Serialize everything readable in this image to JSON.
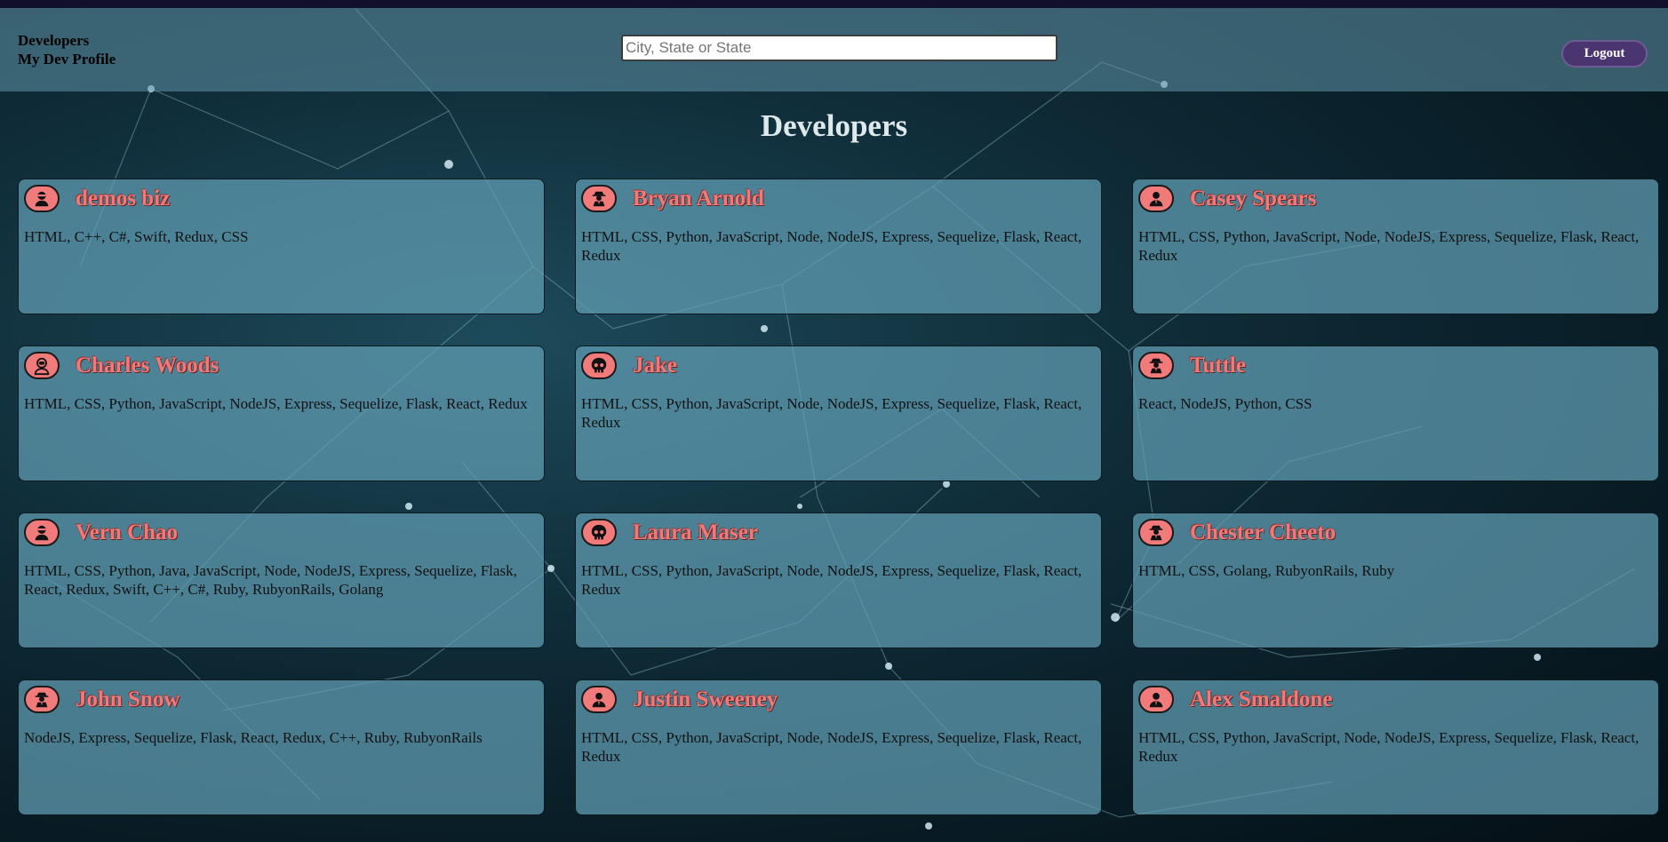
{
  "nav": {
    "links": [
      "Developers",
      "My Dev Profile"
    ]
  },
  "search": {
    "placeholder": "City, State or State",
    "value": ""
  },
  "logout_label": "Logout",
  "page_title": "Developers",
  "developers": [
    {
      "name": "demos biz",
      "icon": "user-ninja-icon",
      "skills": "HTML, C++, C#, Swift, Redux, CSS"
    },
    {
      "name": "Bryan Arnold",
      "icon": "user-secret-icon",
      "skills": "HTML, CSS, Python, JavaScript, Node, NodeJS, Express, Sequelize, Flask, React, Redux"
    },
    {
      "name": "Casey Spears",
      "icon": "user-tie-icon",
      "skills": "HTML, CSS, Python, JavaScript, Node, NodeJS, Express, Sequelize, Flask, React, Redux"
    },
    {
      "name": "Charles Woods",
      "icon": "user-astronaut-icon",
      "skills": "HTML, CSS, Python, JavaScript, NodeJS, Express, Sequelize, Flask, React, Redux"
    },
    {
      "name": "Jake",
      "icon": "skull-icon",
      "skills": "HTML, CSS, Python, JavaScript, Node, NodeJS, Express, Sequelize, Flask, React, Redux"
    },
    {
      "name": "Tuttle",
      "icon": "user-secret-icon",
      "skills": "React, NodeJS, Python, CSS"
    },
    {
      "name": "Vern Chao",
      "icon": "user-ninja-icon",
      "skills": "HTML, CSS, Python, Java, JavaScript, Node, NodeJS, Express, Sequelize, Flask, React, Redux, Swift, C++, C#, Ruby, RubyonRails, Golang"
    },
    {
      "name": "Laura Maser",
      "icon": "skull-icon",
      "skills": "HTML, CSS, Python, JavaScript, Node, NodeJS, Express, Sequelize, Flask, React, Redux"
    },
    {
      "name": "Chester Cheeto",
      "icon": "user-secret-icon",
      "skills": "HTML, CSS, Golang, RubyonRails, Ruby"
    },
    {
      "name": "John Snow",
      "icon": "user-secret-icon",
      "skills": "NodeJS, Express, Sequelize, Flask, React, Redux, C++, Ruby, RubyonRails"
    },
    {
      "name": "Justin Sweeney",
      "icon": "user-tie-icon",
      "skills": "HTML, CSS, Python, JavaScript, Node, NodeJS, Express, Sequelize, Flask, React, Redux"
    },
    {
      "name": "Alex Smaldone",
      "icon": "user-tie-icon",
      "skills": "HTML, CSS, Python, JavaScript, Node, NodeJS, Express, Sequelize, Flask, React, Redux"
    }
  ],
  "colors": {
    "accent_name": "#f07a7a",
    "logout_bg": "#4a3570",
    "card_bg": "#62a0b6"
  }
}
